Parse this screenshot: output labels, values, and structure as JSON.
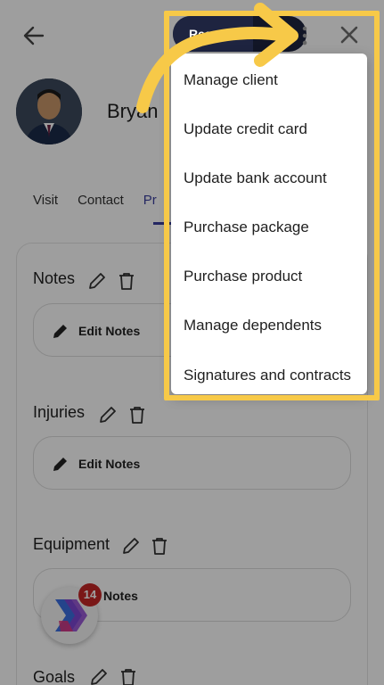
{
  "header": {
    "back_icon": "arrow-left-icon",
    "reschedule_label": "Resc",
    "more_icon": "kebab-vertical-icon",
    "close_icon": "close-x-icon"
  },
  "client": {
    "name": "Bryan I"
  },
  "tabs": [
    {
      "label": "Visit"
    },
    {
      "label": "Contact"
    },
    {
      "label": "Pr"
    }
  ],
  "sections": [
    {
      "title": "Notes",
      "button_label": "Edit Notes"
    },
    {
      "title": "Injuries",
      "button_label": "Edit Notes"
    },
    {
      "title": "Equipment",
      "button_label": "Notes"
    },
    {
      "title": "Goals"
    }
  ],
  "notification_badge": "14",
  "menu": {
    "items": [
      {
        "label": "Manage client"
      },
      {
        "label": "Update credit card"
      },
      {
        "label": "Update bank account"
      },
      {
        "label": "Purchase package"
      },
      {
        "label": "Purchase product"
      },
      {
        "label": "Manage dependents"
      },
      {
        "label": "Signatures and contracts"
      }
    ]
  },
  "colors": {
    "highlight": "#f7c948",
    "accent": "#3a3f9e",
    "dark_button": "#1e2440",
    "badge": "#c62828"
  }
}
